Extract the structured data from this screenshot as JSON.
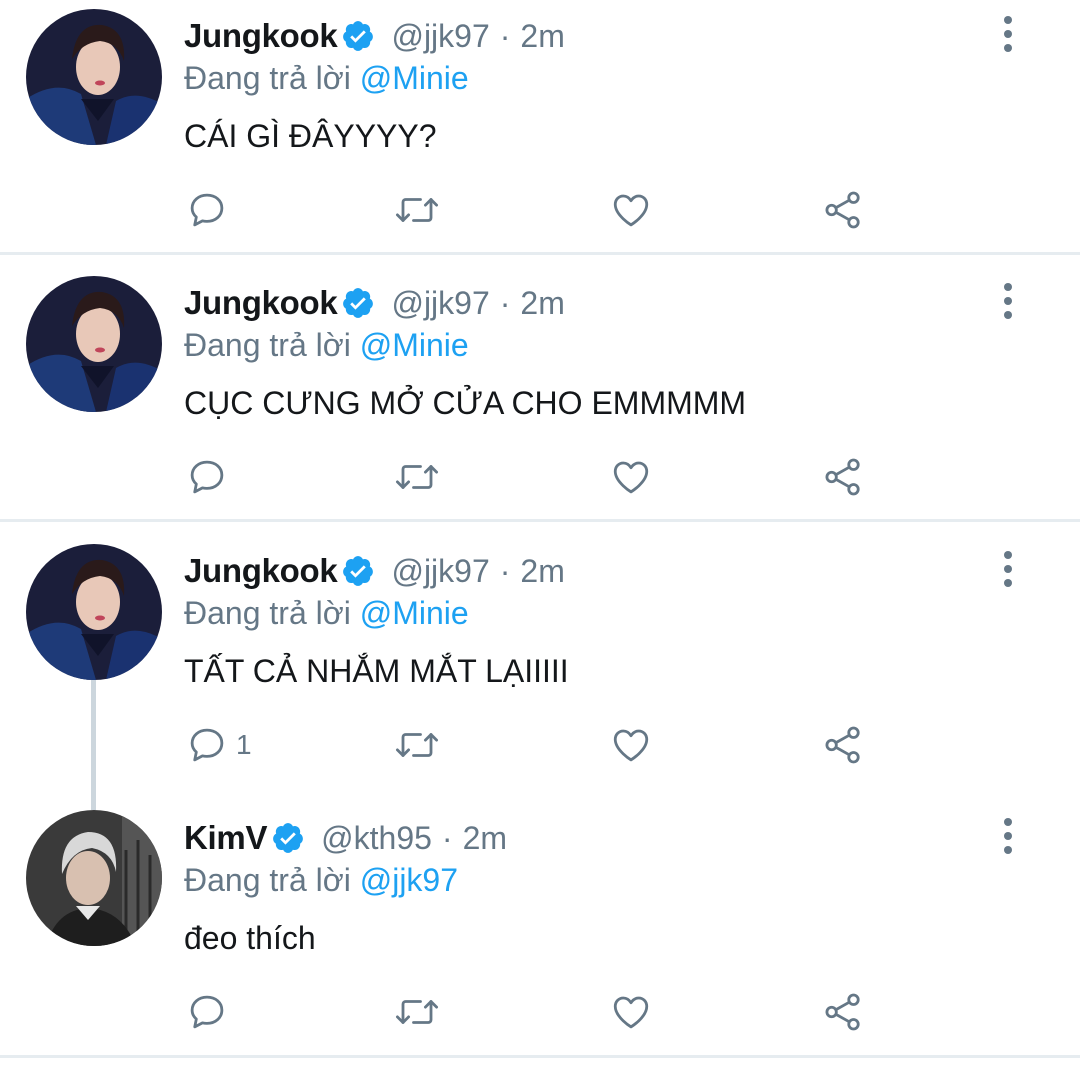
{
  "colors": {
    "accent": "#1da1f2",
    "muted": "#657786",
    "text": "#14171a",
    "divider": "#e6ecf0",
    "thread_line": "#ccd6dd"
  },
  "tweets": [
    {
      "name": "Jungkook",
      "verified": true,
      "handle": "@jjk97",
      "separator": "·",
      "time": "2m",
      "reply_prefix": "Đang trả lời",
      "reply_to": "@Minie",
      "text": "CÁI GÌ ĐÂYYYY?",
      "reply_count": ""
    },
    {
      "name": "Jungkook",
      "verified": true,
      "handle": "@jjk97",
      "separator": "·",
      "time": "2m",
      "reply_prefix": "Đang trả lời",
      "reply_to": "@Minie",
      "text": "CỤC CƯNG MỞ CỬA CHO EMMMMM",
      "reply_count": ""
    },
    {
      "name": "Jungkook",
      "verified": true,
      "handle": "@jjk97",
      "separator": "·",
      "time": "2m",
      "reply_prefix": "Đang trả lời",
      "reply_to": "@Minie",
      "text": "TẤT CẢ NHẮM MẮT LẠIIIII",
      "reply_count": "1"
    },
    {
      "name": "KimV",
      "verified": true,
      "handle": "@kth95",
      "separator": "·",
      "time": "2m",
      "reply_prefix": "Đang trả lời",
      "reply_to": "@jjk97",
      "text": "đeo thích",
      "reply_count": ""
    }
  ],
  "icons": {
    "reply": "reply-icon",
    "retweet": "retweet-icon",
    "like": "heart-icon",
    "share": "share-icon",
    "more": "more-vertical-icon",
    "verified": "verified-badge-icon"
  }
}
